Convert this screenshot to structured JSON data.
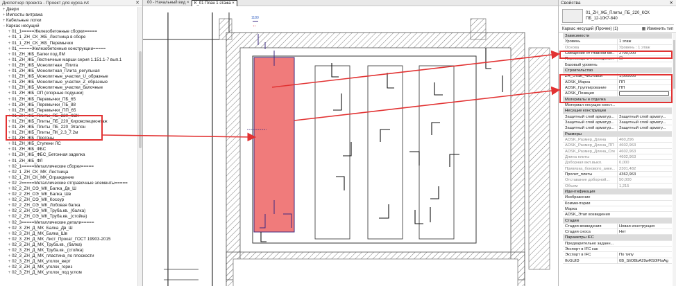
{
  "browser": {
    "title": "Диспетчер проекта - Проект для курса.rvt",
    "close_icon": "close-icon",
    "items": [
      {
        "exp": "+",
        "indent": 1,
        "label": "Двери"
      },
      {
        "exp": "+",
        "indent": 1,
        "label": "Импосты витража"
      },
      {
        "exp": "+",
        "indent": 1,
        "label": "Кабельные лотки"
      },
      {
        "exp": "−",
        "indent": 1,
        "label": "Каркас несущий"
      },
      {
        "exp": "+",
        "indent": 2,
        "label": "01_1=====Железобетонные сборки====="
      },
      {
        "exp": "+",
        "indent": 2,
        "label": "01_1_ZH_СК_ЖБ_Лестница в сборе"
      },
      {
        "exp": "+",
        "indent": 2,
        "label": "01_1_ZH_СК_ЖБ_Перемычки"
      },
      {
        "exp": "+",
        "indent": 2,
        "label": "01_=====Железобетонные конструкции====="
      },
      {
        "exp": "+",
        "indent": 2,
        "label": "01_ZH_ЖБ_Балки под ЛМ"
      },
      {
        "exp": "+",
        "indent": 2,
        "label": "01_ZH_ЖБ_Лестничные марши серия 1.151.1-7 вып.1"
      },
      {
        "exp": "+",
        "indent": 2,
        "label": "01_ZH_ЖБ_Монолитная _Плита"
      },
      {
        "exp": "+",
        "indent": 2,
        "label": "01_ZH_ЖБ_Монолитная_Плита_регульная"
      },
      {
        "exp": "+",
        "indent": 2,
        "label": "01_ZH_ЖБ_Монолитные_участки_U_образные"
      },
      {
        "exp": "+",
        "indent": 2,
        "label": "01_ZH_ЖБ_Монолитные_участки_Z_образные"
      },
      {
        "exp": "+",
        "indent": 2,
        "label": "01_ZH_ЖБ_Монолитные_участки_балочные"
      },
      {
        "exp": "+",
        "indent": 2,
        "label": "01_ZH_ЖБ_ОП (опорные подушки)"
      },
      {
        "exp": "+",
        "indent": 2,
        "label": "01_ZH_ЖБ_Перемычки_ПБ_65"
      },
      {
        "exp": "+",
        "indent": 2,
        "label": "01_ZH_ЖБ_Перемычки_ПБ_88"
      },
      {
        "exp": "+",
        "indent": 2,
        "label": "01_ZH_ЖБ_Перемычки_ПП_65"
      },
      {
        "exp": "+",
        "indent": 2,
        "label": "01_ZH_ЖБ_Плиты_ПБ_220_КСК"
      },
      {
        "exp": "+",
        "indent": 2,
        "label": "01_ZH_ЖБ_Плиты_ПБ_220_Кировспецмонтаж"
      },
      {
        "exp": "+",
        "indent": 2,
        "label": "01_ZH_ЖБ_Плиты_ПБ_220_Эталон"
      },
      {
        "exp": "+",
        "indent": 2,
        "label": "01_ZH_ЖБ_Плиты_ПК_2.3_7.2м"
      },
      {
        "exp": "+",
        "indent": 2,
        "label": "01_ZH_ЖБ_Прогоны"
      },
      {
        "exp": "+",
        "indent": 2,
        "label": "01_ZH_ЖБ_Ступени ЛС"
      },
      {
        "exp": "+",
        "indent": 2,
        "label": "01_ZH_ЖБ_ФБС"
      },
      {
        "exp": "+",
        "indent": 2,
        "label": "01_ZH_ЖБ_ФБС_Бетонная заделка"
      },
      {
        "exp": "+",
        "indent": 2,
        "label": "01_ZH_ЖБ_ФЛ"
      },
      {
        "exp": "+",
        "indent": 2,
        "label": "02_1=====Металлические сборки====="
      },
      {
        "exp": "+",
        "indent": 2,
        "label": "02_1_ZH_СК_МК_Лестница"
      },
      {
        "exp": "+",
        "indent": 2,
        "label": "02_1_ZH_СК_МК_Ограждение"
      },
      {
        "exp": "+",
        "indent": 2,
        "label": "02_2=====Металлические отправочные элементы====="
      },
      {
        "exp": "+",
        "indent": 2,
        "label": "02_2_ZH_ОЭ_МК_Балка_Дв_Ш"
      },
      {
        "exp": "+",
        "indent": 2,
        "label": "02_2_ZH_ОЭ_МК_Балка_Шв"
      },
      {
        "exp": "+",
        "indent": 2,
        "label": "02_2_ZH_ОЭ_МК_Косоур"
      },
      {
        "exp": "+",
        "indent": 2,
        "label": "02_2_ZH_ОЭ_МК_Лобовая балка"
      },
      {
        "exp": "+",
        "indent": 2,
        "label": "02_2_ZH_ОЭ_МК_Труба.кв._(балка)"
      },
      {
        "exp": "+",
        "indent": 2,
        "label": "02_2_ZH_ОЭ_МК_Труба.кв._(стойка)"
      },
      {
        "exp": "+",
        "indent": 2,
        "label": "02_3=====Металлические детали====="
      },
      {
        "exp": "+",
        "indent": 2,
        "label": "02_3_ZH_Д_МК_Балка_Дв_Ш"
      },
      {
        "exp": "+",
        "indent": 2,
        "label": "02_3_ZH_Д_МК_Балка_Шв"
      },
      {
        "exp": "+",
        "indent": 2,
        "label": "02_3_ZH_Д_МК_Лист_Прокат_ГОСТ 19903-2015"
      },
      {
        "exp": "+",
        "indent": 2,
        "label": "02_3_ZH_Д_МК_Труба.кв._(балка)"
      },
      {
        "exp": "+",
        "indent": 2,
        "label": "02_3_ZH_Д_МК_Труба.кв._(стойка)"
      },
      {
        "exp": "+",
        "indent": 2,
        "label": "02_3_ZH_Д_МК_пластина_по плоскости"
      },
      {
        "exp": "+",
        "indent": 2,
        "label": "02_3_ZH_Д_МК_уголок_верт"
      },
      {
        "exp": "+",
        "indent": 2,
        "label": "02_3_ZH_Д_МК_уголок_гориз"
      },
      {
        "exp": "+",
        "indent": 2,
        "label": "02_3_ZH_Д_МК_уголок_под углом"
      }
    ]
  },
  "view": {
    "tabs": [
      {
        "label": "00 - Начальный вид",
        "close": "×"
      },
      {
        "label": "К_01 План 1 этажа",
        "close": "×"
      }
    ],
    "dim_label": "1180"
  },
  "props": {
    "title": "Свойства",
    "type_name_1": "01_ZH_ЖБ_Плиты_ПБ_220_КСК",
    "type_name_2": "ПБ_12-10К7-840",
    "filter": "Каркас несущий (Прочее) (1)",
    "edit_type": "Изменить тип",
    "rows": [
      {
        "kind": "section",
        "k": "Зависимости"
      },
      {
        "kind": "normal",
        "k": "Уровень",
        "v": "1 этаж"
      },
      {
        "kind": "grey",
        "k": "Основа",
        "v": "Уровень : 1 этаж"
      },
      {
        "kind": "normal",
        "k": "Смещение от главной мо...",
        "v": "2700,000"
      },
      {
        "kind": "normal",
        "k": "Перемещать с соседним...",
        "v": "☐"
      },
      {
        "kind": "normal",
        "k": "Базовый уровень",
        "v": ""
      },
      {
        "kind": "section",
        "k": "Строительство"
      },
      {
        "kind": "normal",
        "k": "ZH_Этаж_Числовой",
        "v": "1,000000"
      },
      {
        "kind": "normal",
        "k": "ADSK_Марка",
        "v": "ПП"
      },
      {
        "kind": "normal",
        "k": "ADSK_Группирование",
        "v": "ПП"
      },
      {
        "kind": "input",
        "k": "ADSK_Позиция",
        "v": ""
      },
      {
        "kind": "section",
        "k": "Материалы и отделка"
      },
      {
        "kind": "normal",
        "k": "Материал несущих конст...",
        "v": ""
      },
      {
        "kind": "section",
        "k": "Несущие конструкции"
      },
      {
        "kind": "normal",
        "k": "Защитный слой арматур...",
        "v": "Защитный слой армату..."
      },
      {
        "kind": "normal",
        "k": "Защитный слой арматур...",
        "v": "Защитный слой армату..."
      },
      {
        "kind": "normal",
        "k": "Защитный слой арматур...",
        "v": "Защитный слой армату..."
      },
      {
        "kind": "section",
        "k": "Размеры"
      },
      {
        "kind": "grey",
        "k": "ADSK_Размер_Длина",
        "v": "460,296"
      },
      {
        "kind": "grey",
        "k": "ADSK_Размер_Длина_ПП",
        "v": "4602,963"
      },
      {
        "kind": "grey",
        "k": "ADSK_Размер_Длина_Спец",
        "v": "4602,963"
      },
      {
        "kind": "grey",
        "k": "Длина плиты",
        "v": "4602,963"
      },
      {
        "kind": "grey",
        "k": "Доборная вкл.выкл.",
        "v": "0,000"
      },
      {
        "kind": "grey",
        "k": "Привязка_бокового_анке...",
        "v": "2301,482"
      },
      {
        "kind": "normal",
        "k": "Пролет_плиты",
        "v": "4362,963"
      },
      {
        "kind": "grey",
        "k": "Отставание доборной...",
        "v": "50,000"
      },
      {
        "kind": "grey",
        "k": "Объем",
        "v": "1,215"
      },
      {
        "kind": "section",
        "k": "Идентификация"
      },
      {
        "kind": "normal",
        "k": "Изображение",
        "v": ""
      },
      {
        "kind": "normal",
        "k": "Комментарии",
        "v": ""
      },
      {
        "kind": "normal",
        "k": "Марка",
        "v": ""
      },
      {
        "kind": "normal",
        "k": "ADSK_Этап возведения",
        "v": ""
      },
      {
        "kind": "section",
        "k": "Стадии"
      },
      {
        "kind": "normal",
        "k": "Стадия возведения",
        "v": "Новая конструкция"
      },
      {
        "kind": "normal",
        "k": "Стадия сноса",
        "v": "Нет"
      },
      {
        "kind": "section",
        "k": "Параметры IFC"
      },
      {
        "kind": "normal",
        "k": "Предварительно заданн...",
        "v": ""
      },
      {
        "kind": "normal",
        "k": "Экспорт в IFC как",
        "v": ""
      },
      {
        "kind": "normal",
        "k": "Экспорт в IFC",
        "v": "По типу"
      },
      {
        "kind": "normal",
        "k": "IfcGUID",
        "v": "0B_SliOBbA29wRS0lFIaAg"
      }
    ]
  },
  "colors": {
    "highlight": "#e23232",
    "slab_fill": "#f07b7b",
    "hatch": "#8a8a8a"
  }
}
